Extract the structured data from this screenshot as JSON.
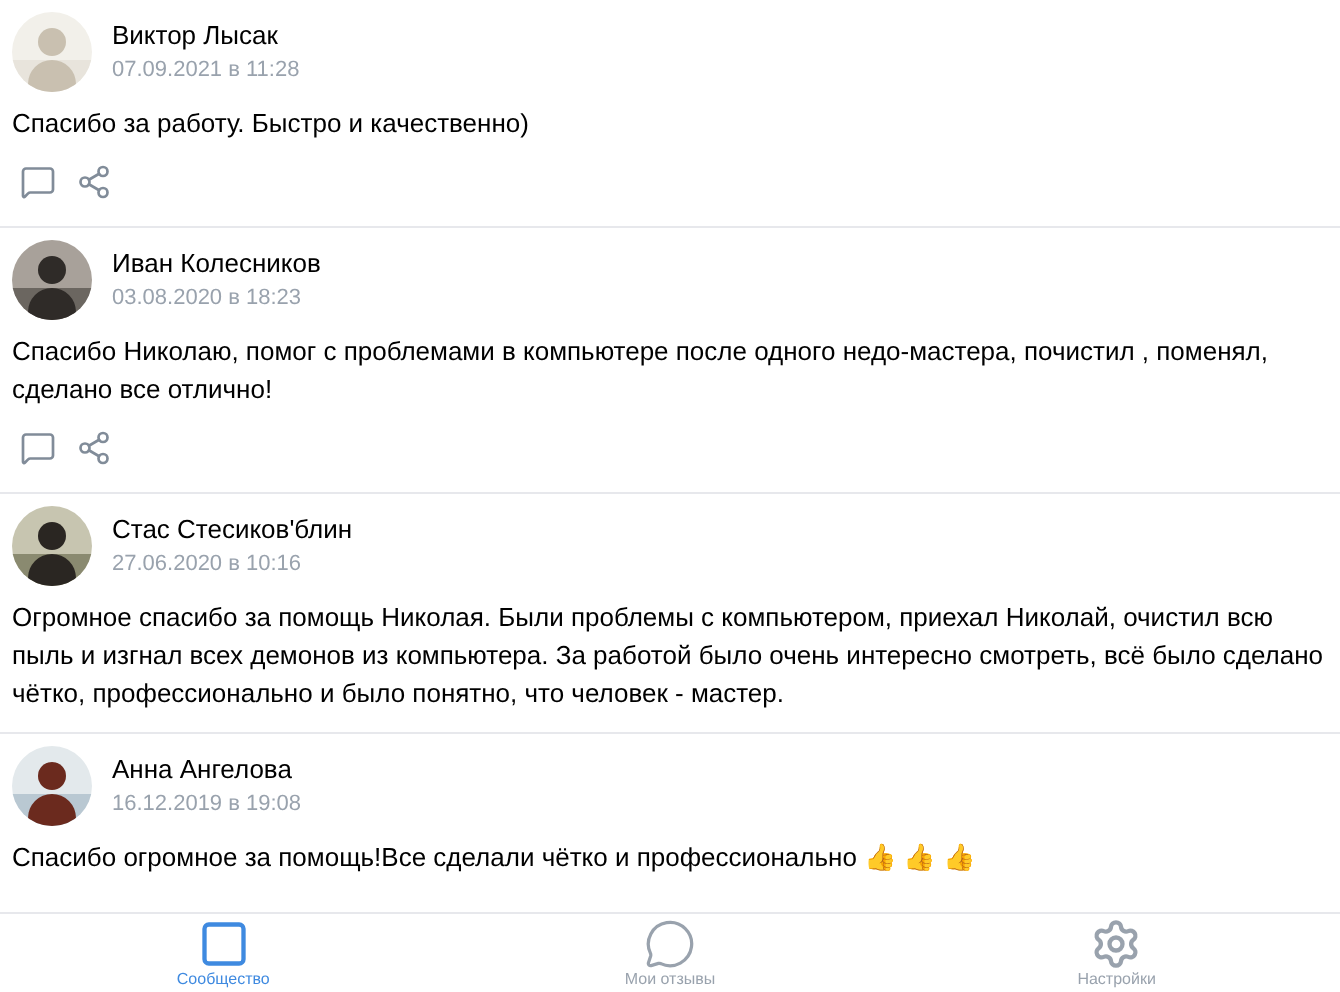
{
  "reviews": [
    {
      "author": "Виктор Лысак",
      "date": "07.09.2021 в 11:28",
      "text": "Спасибо за работу. Быстро и качественно)",
      "actions": true
    },
    {
      "author": "Иван Колесников",
      "date": "03.08.2020 в 18:23",
      "text": "Спасибо Николаю, помог с проблемами в компьютере после одного недо-мастера, почистил , поменял, сделано все отлично!",
      "actions": true
    },
    {
      "author": "Стас Стесиков'блин",
      "date": "27.06.2020 в 10:16",
      "text": "Огромное спасибо за помощь Николая. Были проблемы с компьютером, приехал Николай, очистил всю пыль и изгнал всех демонов из компьютера. За работой было очень интересно смотреть, всё было сделано чётко, профессионально и было понятно, что человек - мастер.",
      "actions": false
    },
    {
      "author": "Анна Ангелова",
      "date": "16.12.2019 в 19:08",
      "text": "Спасибо огромное за помощь!Все сделали чётко и профессионально 👍 👍 👍",
      "actions": false
    }
  ],
  "nav": [
    {
      "kind": "community",
      "label": "Сообщество",
      "selected": true
    },
    {
      "kind": "reviews",
      "label": "Мои отзывы",
      "selected": false
    },
    {
      "kind": "settings",
      "label": "Настройки",
      "selected": false
    }
  ]
}
